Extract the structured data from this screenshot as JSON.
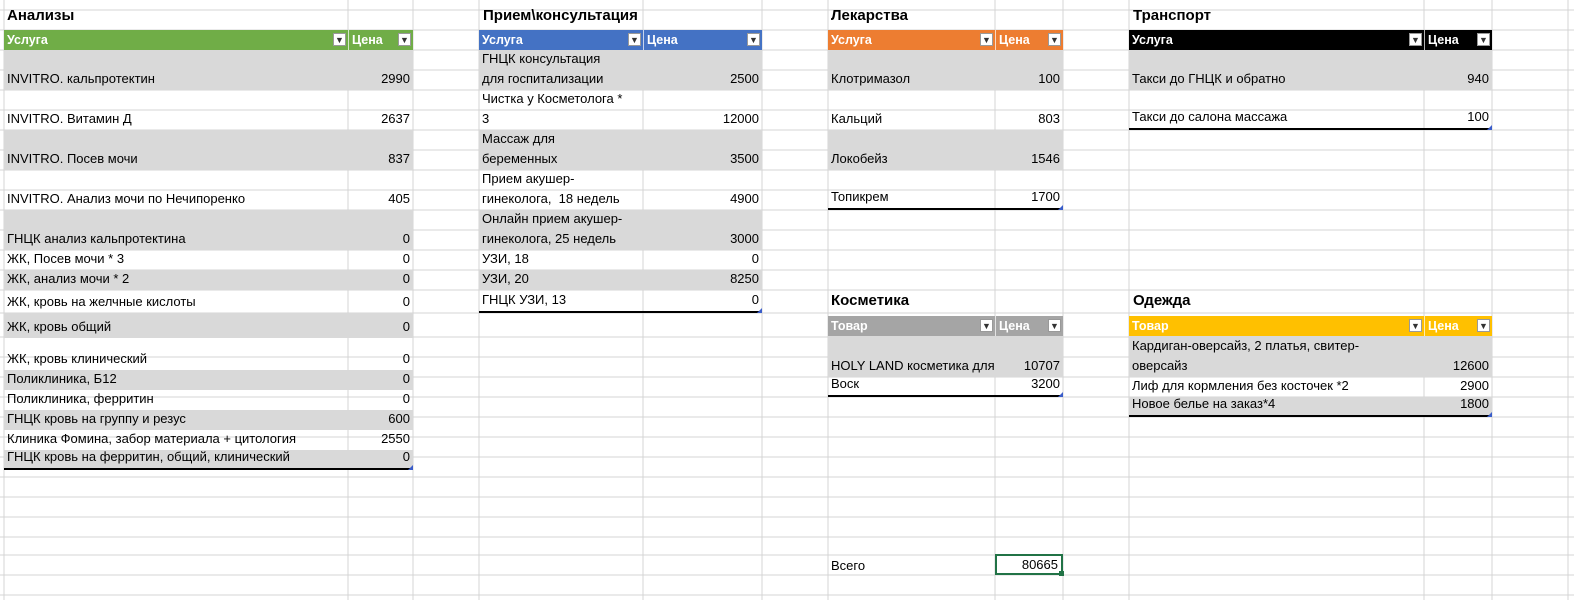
{
  "colors": {
    "analyses_header": "#70ad47",
    "reception_header": "#4472c4",
    "medicine_header": "#ed7d31",
    "transport_header": "#000000",
    "cosmetics_header": "#a5a5a5",
    "clothes_header": "#ffc000",
    "stripe": "#d9d9d9",
    "grid": "#d4d4d4"
  },
  "tables": {
    "analyses": {
      "title": "Анализы",
      "col1": "Услуга",
      "col2": "Цена",
      "rows": [
        {
          "name": "INVITRO. кальпротектин",
          "price": "2990"
        },
        {
          "name": "INVITRO. Витамин Д",
          "price": "2637"
        },
        {
          "name": "INVITRO. Посев мочи",
          "price": "837"
        },
        {
          "name": "INVITRO. Анализ мочи по Нечипоренко",
          "price": "405"
        },
        {
          "name": "ГНЦК анализ кальпротектина",
          "price": "0"
        },
        {
          "name": "ЖК, Посев мочи * 3",
          "price": "0"
        },
        {
          "name": "ЖК, анализ мочи * 2",
          "price": "0"
        },
        {
          "name": "ЖК, кровь на желчные кислоты",
          "price": "0"
        },
        {
          "name": "ЖК, кровь общий",
          "price": "0"
        },
        {
          "name": "ЖК, кровь клинический",
          "price": "0"
        },
        {
          "name": "Поликлиника, Б12",
          "price": "0"
        },
        {
          "name": "Поликлиника, ферритин",
          "price": "0"
        },
        {
          "name": "ГНЦК кровь на группу и резус",
          "price": "600"
        },
        {
          "name": "Клиника Фомина, забор материала + цитология",
          "price": "2550"
        },
        {
          "name": "ГНЦК кровь на ферритин, общий, клинический",
          "price": "0"
        }
      ]
    },
    "reception": {
      "title": "Прием\\консультация",
      "col1": "Услуга",
      "col2": "Цена",
      "rows": [
        {
          "name": "ГНЦК консультация\nдля госпитализации",
          "price": "2500"
        },
        {
          "name": "Чистка у Косметолога *\n3",
          "price": "12000"
        },
        {
          "name": "Массаж для\nбеременных",
          "price": "3500"
        },
        {
          "name": "Прием акушер-\nгинеколога,  18 недель",
          "price": "4900"
        },
        {
          "name": "Онлайн прием акушер-\nгинеколога, 25 недель",
          "price": "3000"
        },
        {
          "name": "УЗИ, 18",
          "price": "0"
        },
        {
          "name": "УЗИ, 20",
          "price": "8250"
        },
        {
          "name": "ГНЦК УЗИ, 13",
          "price": "0"
        }
      ]
    },
    "medicine": {
      "title": "Лекарства",
      "col1": "Услуга",
      "col2": "Цена",
      "rows": [
        {
          "name": "Клотримазол",
          "price": "100"
        },
        {
          "name": "Кальций",
          "price": "803"
        },
        {
          "name": "Локобейз",
          "price": "1546"
        },
        {
          "name": "Топикрем",
          "price": "1700"
        }
      ]
    },
    "transport": {
      "title": "Транспорт",
      "col1": "Услуга",
      "col2": "Цена",
      "rows": [
        {
          "name": "Такси до ГНЦК и обратно",
          "price": "940"
        },
        {
          "name": "Такси до салона массажа",
          "price": "100"
        }
      ]
    },
    "cosmetics": {
      "title": "Косметика",
      "col1": "Товар",
      "col2": "Цена",
      "rows": [
        {
          "name": "HOLY LAND косметика для лица",
          "price": "10707"
        },
        {
          "name": "Воск",
          "price": "3200"
        }
      ]
    },
    "clothes": {
      "title": "Одежда",
      "col1": "Товар",
      "col2": "Цена",
      "rows": [
        {
          "name": "Кардиган-оверсайз, 2 платья, свитер-\nоверсайз",
          "price": "12600"
        },
        {
          "name": "Лиф для кормления без косточек *2",
          "price": "2900"
        },
        {
          "name": "Новое белье на заказ*4",
          "price": "1800"
        }
      ]
    }
  },
  "total": {
    "label": "Всего",
    "value": "80665"
  }
}
